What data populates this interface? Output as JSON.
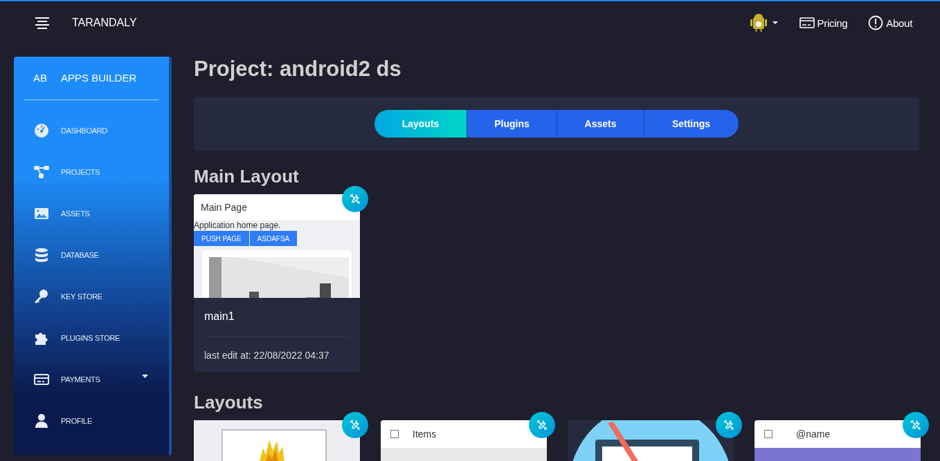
{
  "topbar": {
    "brand": "TARANDALY",
    "links": [
      {
        "label": "Pricing",
        "kind": "pricing"
      },
      {
        "label": "About",
        "kind": "about"
      }
    ]
  },
  "sidebar": {
    "badge": "AB",
    "title": "APPS BUILDER",
    "items": [
      {
        "label": "DASHBOARD",
        "kind": "link"
      },
      {
        "label": "PROJECTS",
        "kind": "link"
      },
      {
        "label": "ASSETS",
        "kind": "link"
      },
      {
        "label": "DATABASE",
        "kind": "link"
      },
      {
        "label": "KEY STORE",
        "kind": "link"
      },
      {
        "label": "PLUGINS STORE",
        "kind": "link"
      },
      {
        "label": "PAYMENTS",
        "kind": "group"
      },
      {
        "label": "PROFILE",
        "kind": "link"
      }
    ]
  },
  "page_title": "Project: android2 ds",
  "tabs": [
    {
      "label": "Layouts",
      "selected": true
    },
    {
      "label": "Plugins",
      "selected": false
    },
    {
      "label": "Assets",
      "selected": false
    },
    {
      "label": "Settings",
      "selected": false
    }
  ],
  "main_layout": {
    "heading": "Main Layout",
    "card": {
      "preview": {
        "title": "Main Page",
        "text": "Application home page.",
        "buttons": [
          "PUSH PAGE",
          "ASDAFSA"
        ]
      },
      "name": "main1",
      "edited": "last edit at: 22/08/2022 04:37"
    }
  },
  "layouts": {
    "heading": "Layouts",
    "cards": [
      {
        "kind": "picture"
      },
      {
        "kind": "list",
        "label": "Items",
        "checked": false
      },
      {
        "kind": "picture"
      },
      {
        "kind": "list",
        "label": "@name",
        "checked": false
      }
    ]
  }
}
